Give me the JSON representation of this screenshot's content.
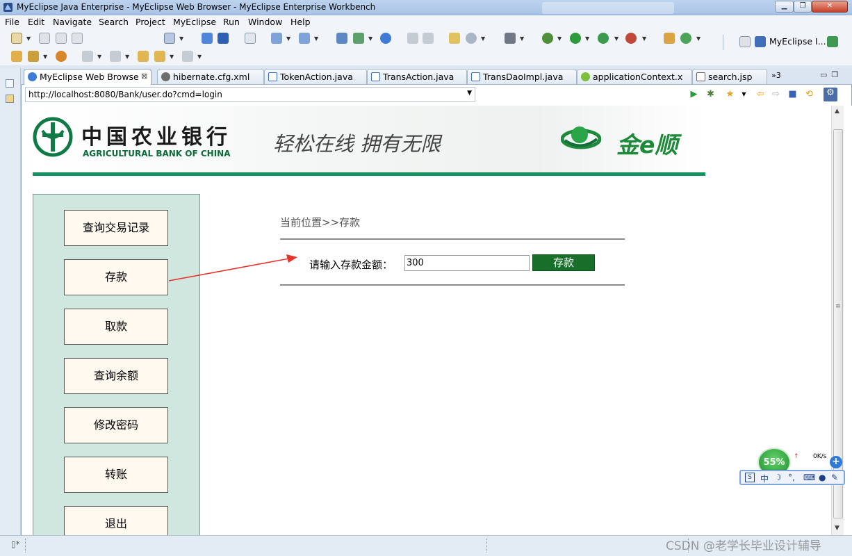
{
  "window": {
    "title": "MyEclipse Java Enterprise - MyEclipse Web Browser - MyEclipse Enterprise Workbench"
  },
  "menu": [
    "File",
    "Edit",
    "Navigate",
    "Search",
    "Project",
    "MyEclipse",
    "Run",
    "Window",
    "Help"
  ],
  "perspective": {
    "label": "MyEclipse I..."
  },
  "tabs": [
    {
      "label": "MyEclipse Web Browse",
      "active": true,
      "icon": "globe-icon"
    },
    {
      "label": "hibernate.cfg.xml",
      "icon": "xml-icon"
    },
    {
      "label": "TokenAction.java",
      "icon": "java-file-icon"
    },
    {
      "label": "TransAction.java",
      "icon": "java-file-icon"
    },
    {
      "label": "TransDaoImpl.java",
      "icon": "java-file-icon"
    },
    {
      "label": "applicationContext.x",
      "icon": "spring-icon"
    },
    {
      "label": "search.jsp",
      "icon": "jsp-file-icon"
    }
  ],
  "tabs_overflow": "»3",
  "browser": {
    "url": "http://localhost:8080/Bank/user.do?cmd=login"
  },
  "bank": {
    "name_cn": "中国农业银行",
    "name_en": "AGRICULTURAL BANK OF CHINA",
    "slogan": "轻松在线  拥有无限",
    "product": "金e顺"
  },
  "sidebar": {
    "items": [
      "查询交易记录",
      "存款",
      "取款",
      "查询余额",
      "修改密码",
      "转账",
      "退出"
    ]
  },
  "content": {
    "breadcrumb": "当前位置>>存款",
    "deposit_label": "请输入存款金额：",
    "deposit_value": "300",
    "deposit_button": "存款"
  },
  "tray": {
    "percent": "55%",
    "rate": "0K/s",
    "ime_mode": "中"
  },
  "watermark": "CSDN @老学长毕业设计辅导"
}
